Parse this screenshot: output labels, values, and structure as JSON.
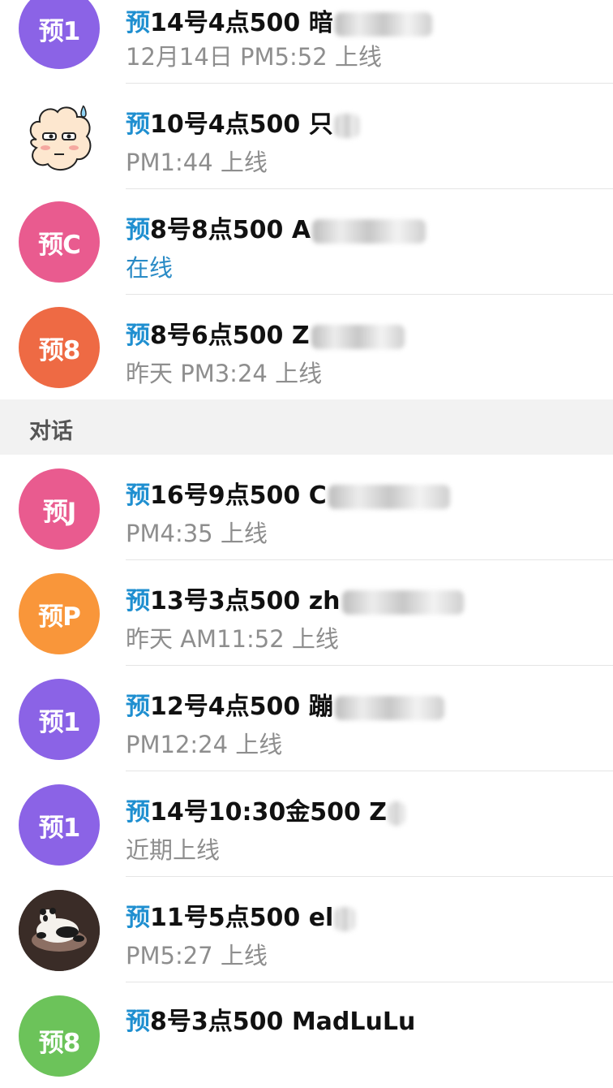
{
  "section_header": "对话",
  "contacts_top": [
    {
      "avatar": "预1",
      "avatar_color": "#8b63e6",
      "tag": "预",
      "name": "14号4点500 暗",
      "status": "12月14日 PM5:52 上线",
      "online": false
    },
    {
      "avatar_icon": "cartoon-face-avatar",
      "tag": "预",
      "name": "10号4点500 只",
      "status": "PM1:44 上线",
      "online": false
    },
    {
      "avatar": "预C",
      "avatar_color": "#e95b8f",
      "tag": "预",
      "name": "8号8点500 A",
      "status": "在线",
      "online": true
    },
    {
      "avatar": "预8",
      "avatar_color": "#ee6a44",
      "tag": "预",
      "name": "8号6点500 Z",
      "status": "昨天 PM3:24 上线",
      "online": false
    }
  ],
  "contacts_dialogs": [
    {
      "avatar": "预J",
      "avatar_color": "#e95b8f",
      "tag": "预",
      "name": "16号9点500 C",
      "status": "PM4:35 上线",
      "online": false
    },
    {
      "avatar": "预P",
      "avatar_color": "#f9963a",
      "tag": "预",
      "name": "13号3点500 zh",
      "status": "昨天 AM11:52 上线",
      "online": false
    },
    {
      "avatar": "预1",
      "avatar_color": "#8b63e6",
      "tag": "预",
      "name": "12号4点500 蹦",
      "status": "PM12:24 上线",
      "online": false
    },
    {
      "avatar": "预1",
      "avatar_color": "#8b63e6",
      "tag": "预",
      "name": "14号10:30金500 Z",
      "status": "近期上线",
      "online": false
    },
    {
      "avatar_icon": "panda-photo-avatar",
      "tag": "预",
      "name": "11号5点500 el",
      "status": "PM5:27 上线",
      "online": false
    },
    {
      "avatar": "预8",
      "avatar_color": "#6cc35a",
      "tag": "预",
      "name": "8号3点500 MadLuLu",
      "status": "",
      "online": false
    }
  ]
}
